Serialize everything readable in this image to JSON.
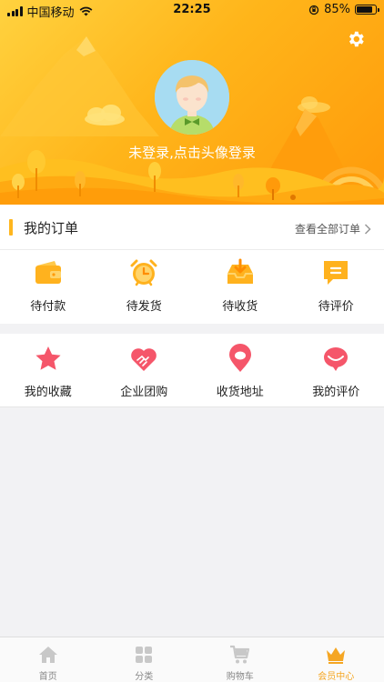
{
  "status_bar": {
    "carrier": "中国移动",
    "time": "22:25",
    "battery": "85%",
    "battery_level": 0.85
  },
  "header": {
    "login_prompt": "未登录,点击头像登录"
  },
  "orders": {
    "title": "我的订单",
    "view_all": "查看全部订单",
    "items": [
      {
        "label": "待付款",
        "icon": "wallet-icon"
      },
      {
        "label": "待发货",
        "icon": "alarm-clock-icon"
      },
      {
        "label": "待收货",
        "icon": "inbox-download-icon"
      },
      {
        "label": "待评价",
        "icon": "comment-icon"
      }
    ]
  },
  "services": {
    "items": [
      {
        "label": "我的收藏",
        "icon": "star-icon"
      },
      {
        "label": "企业团购",
        "icon": "handshake-heart-icon"
      },
      {
        "label": "收货地址",
        "icon": "location-pin-icon"
      },
      {
        "label": "我的评价",
        "icon": "chat-bubble-icon"
      }
    ]
  },
  "tabbar": {
    "items": [
      {
        "label": "首页",
        "icon": "home-icon"
      },
      {
        "label": "分类",
        "icon": "category-grid-icon"
      },
      {
        "label": "购物车",
        "icon": "cart-icon"
      },
      {
        "label": "会员中心",
        "icon": "crown-icon",
        "active": true
      }
    ]
  },
  "colors": {
    "accent": "#f5a623",
    "header_start": "#ffd23f",
    "header_end": "#ff9a0a",
    "favorite": "#f5566a"
  }
}
